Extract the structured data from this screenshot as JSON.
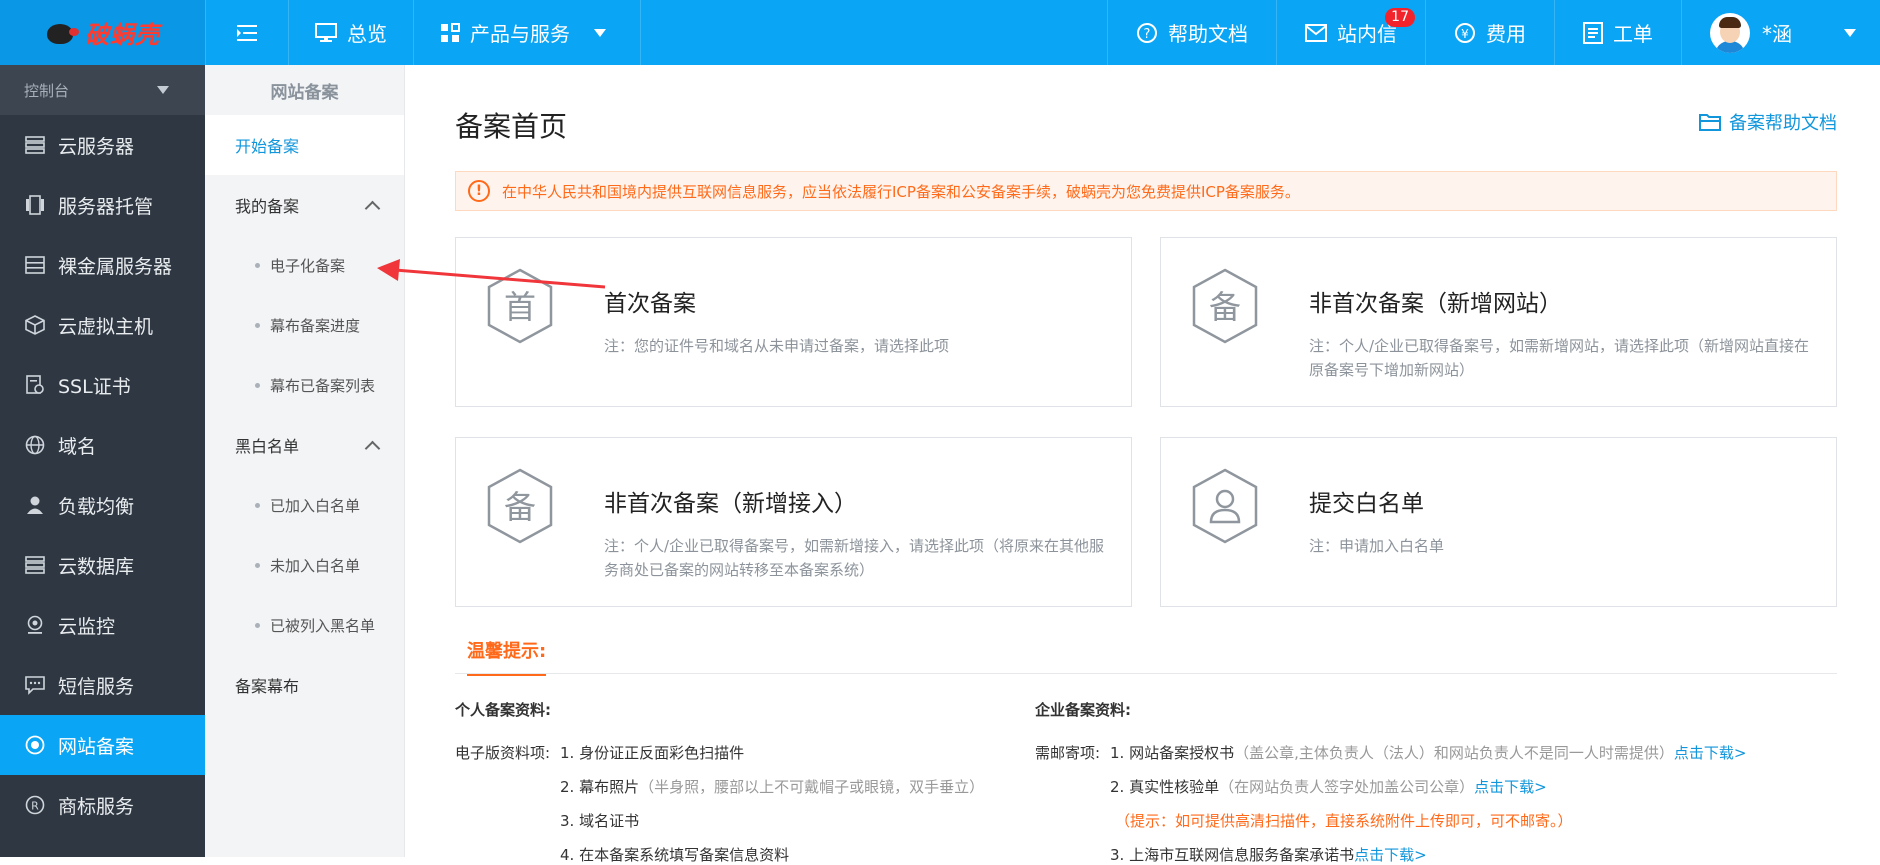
{
  "brand": {
    "name": "破蜗壳"
  },
  "topbar": {
    "overview": "总览",
    "products": "产品与服务",
    "help_docs": "帮助文档",
    "messages": "站内信",
    "messages_badge": "17",
    "billing": "费用",
    "tickets": "工单",
    "user": "*涵"
  },
  "sidebar": {
    "console": "控制台",
    "items": [
      {
        "label": "云服务器",
        "icon": "server-list-icon"
      },
      {
        "label": "服务器托管",
        "icon": "hosting-icon"
      },
      {
        "label": "裸金属服务器",
        "icon": "bare-metal-icon"
      },
      {
        "label": "云虚拟主机",
        "icon": "cube-icon"
      },
      {
        "label": "SSL证书",
        "icon": "certificate-icon"
      },
      {
        "label": "域名",
        "icon": "globe-icon"
      },
      {
        "label": "负载均衡",
        "icon": "load-balancer-icon"
      },
      {
        "label": "云数据库",
        "icon": "database-icon"
      },
      {
        "label": "云监控",
        "icon": "monitor-icon"
      },
      {
        "label": "短信服务",
        "icon": "sms-icon"
      },
      {
        "label": "网站备案",
        "icon": "record-icon"
      },
      {
        "label": "商标服务",
        "icon": "trademark-icon"
      }
    ]
  },
  "subnav": {
    "title": "网站备案",
    "start": "开始备案",
    "my_records": "我的备案",
    "my_records_items": [
      "电子化备案",
      "幕布备案进度",
      "幕布已备案列表"
    ],
    "blackwhite": "黑白名单",
    "blackwhite_items": [
      "已加入白名单",
      "未加入白名单",
      "已被列入黑名单"
    ],
    "curtain": "备案幕布"
  },
  "main": {
    "title": "备案首页",
    "help_link": "备案帮助文档",
    "notice": "在中华人民共和国境内提供互联网信息服务，应当依法履行ICP备案和公安备案手续，破蜗壳为您免费提供ICP备案服务。",
    "cards": [
      {
        "glyph": "首",
        "title": "首次备案",
        "note": "注：您的证件号和域名从未申请过备案，请选择此项"
      },
      {
        "glyph": "备",
        "title": "非首次备案（新增网站）",
        "note": "注：个人/企业已取得备案号，如需新增网站，请选择此项（新增网站直接在原备案号下增加新网站）"
      },
      {
        "glyph": "备",
        "title": "非首次备案（新增接入）",
        "note": "注：个人/企业已取得备案号，如需新增接入，请选择此项（将原来在其他服务商处已备案的网站转移至本备案系统）"
      },
      {
        "glyph": "",
        "title": "提交白名单",
        "note": "注：申请加入白名单"
      }
    ],
    "tips_tab": "温馨提示:",
    "personal": {
      "heading": "个人备案资料:",
      "label": "电子版资料项:",
      "item1": "1. 身份证正反面彩色扫描件",
      "item2": "2. 幕布照片",
      "item2_note": "（半身照，腰部以上不可戴帽子或眼镜，双手垂立）",
      "item3": "3. 域名证书",
      "item4": "4. 在本备案系统填写备案信息资料"
    },
    "enterprise": {
      "heading": "企业备案资料:",
      "label": "需邮寄项:",
      "item1": "1. 网站备案授权书",
      "item1_note": "（盖公章,主体负责人（法人）和网站负责人不是同一人时需提供）",
      "item1_link": "点击下载>",
      "item2": "2. 真实性核验单",
      "item2_note": "（在网站负责人签字处加盖公司公章）",
      "item2_link": "点击下载>",
      "hint": "（提示：如可提供高清扫描件，直接系统附件上传即可，可不邮寄。）",
      "item3": "3. 上海市互联网信息服务备案承诺书",
      "item3_link": "点击下载>"
    }
  },
  "colors": {
    "primary": "#0aa5f5",
    "sidebar_bg": "#2f3742",
    "accent_orange": "#ff6a1a",
    "link_blue": "#1296db"
  }
}
